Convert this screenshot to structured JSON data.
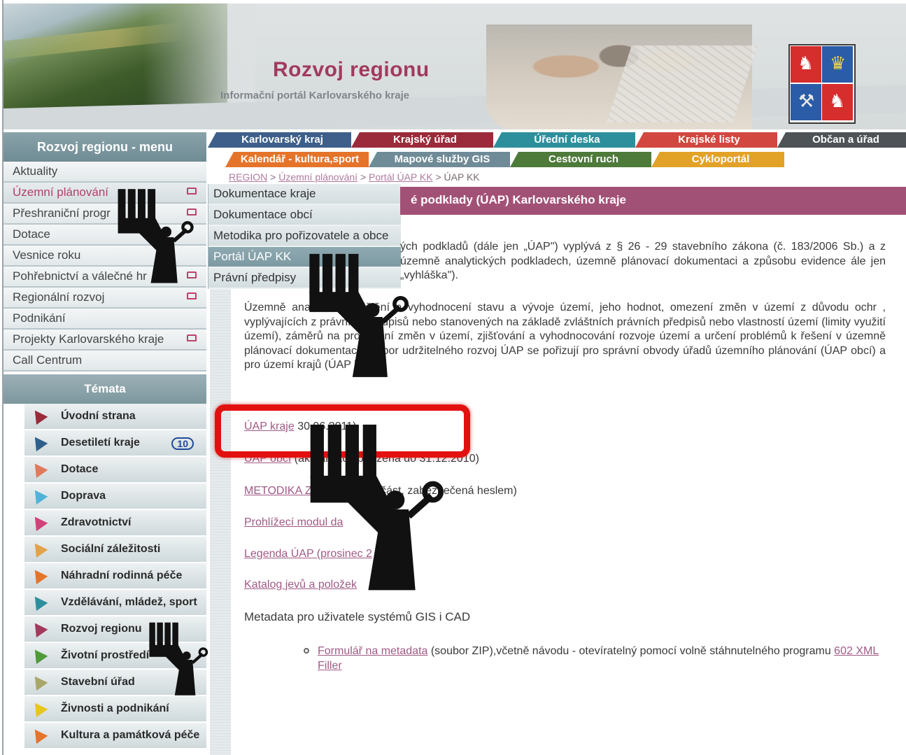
{
  "header": {
    "title": "Rozvoj regionu",
    "subtitle": "Informační portál Karlovarského kraje"
  },
  "nav_row1": [
    {
      "label": "Karlovarský kraj",
      "color": "#3d5f8a"
    },
    {
      "label": "Krajský úřad",
      "color": "#9b2b3a"
    },
    {
      "label": "Úřední deska",
      "color": "#2e8f9c"
    },
    {
      "label": "Krajské listy",
      "color": "#d2473f"
    },
    {
      "label": "Občan a úřad",
      "color": "#4d5357"
    }
  ],
  "nav_row2": [
    {
      "label": "Kalendář - kultura,sport",
      "color": "#e5742b"
    },
    {
      "label": "Mapové služby GIS",
      "color": "#6f8b97"
    },
    {
      "label": "Cestovní ruch",
      "color": "#4e7a3a"
    },
    {
      "label": "Cykloportál",
      "color": "#e2a227"
    }
  ],
  "breadcrumb": {
    "items": [
      "REGION",
      "Územní plánování",
      "Portál ÚAP KK"
    ],
    "separator": ">",
    "current": "ÚAP KK"
  },
  "left_menu": {
    "title": "Rozvoj regionu - menu",
    "items": [
      {
        "label": "Aktuality"
      },
      {
        "label": "Územní plánování",
        "active": true,
        "folder": true
      },
      {
        "label": "Přeshraniční progr",
        "folder": true
      },
      {
        "label": "Dotace"
      },
      {
        "label": "Vesnice roku"
      },
      {
        "label": "Pohřebnictví a válečné hr",
        "folder": true
      },
      {
        "label": "Regionální rozvoj",
        "folder": true
      },
      {
        "label": "Podnikání"
      },
      {
        "label": "Projekty Karlovarského kraje",
        "folder": true
      },
      {
        "label": "Call Centrum"
      }
    ]
  },
  "themes": {
    "title": "Témata",
    "items": [
      {
        "label": "Úvodní strana",
        "color": "#9b2b3a"
      },
      {
        "label": "Desetiletí kraje",
        "color": "#2e5f8a",
        "logo": "10"
      },
      {
        "label": "Dotace",
        "color": "#e07a5a"
      },
      {
        "label": "Doprava",
        "color": "#4fb3d9"
      },
      {
        "label": "Zdravotnictví",
        "color": "#d2407a"
      },
      {
        "label": "Sociální záležitosti",
        "color": "#e2a24a"
      },
      {
        "label": "Náhradní rodinná péče",
        "color": "#e5742b"
      },
      {
        "label": "Vzdělávání, mládež, sport",
        "color": "#2e8f9c"
      },
      {
        "label": "Rozvoj regionu",
        "color": "#a13a5c"
      },
      {
        "label": "Životní prostředí",
        "color": "#4f9a3a"
      },
      {
        "label": "Stavební úřad",
        "color": "#a9a66a"
      },
      {
        "label": "Živnosti a podnikání",
        "color": "#e8c61f"
      },
      {
        "label": "Kultura a památková péče",
        "color": "#e5742b"
      }
    ]
  },
  "submenu": {
    "items": [
      {
        "label": "Dokumentace kraje"
      },
      {
        "label": "Dokumentace obcí"
      },
      {
        "label": "Metodika pro pořizovatele a obce"
      },
      {
        "label": "Portál ÚAP KK",
        "active": true
      },
      {
        "label": "Právní předpisy"
      }
    ]
  },
  "content": {
    "title": "é podklady (ÚAP) Karlovarského kraje",
    "intro": "ých podkladů (dále jen „ÚAP\") vyplývá z § 26 - 29 stavebního zákona (č. 183/2006 Sb.) a z územně analytických podkladech, územně plánovací dokumentaci a způsobu evidence ále jen „vyhláška\").",
    "body": "Územně anal sahují zjištění a vyhodnocení stavu a vývoje území, jeho hodnot, omezení změn v území z důvodu ochr , vyplývajících z právních předpisů nebo stanovených na základě zvláštních právních předpisů nebo vlastností území (limity využití území), záměrů na provedení změn v území, zjišťování a vyhodnocování rozvoje území a určení problémů k řešení v územně plánovací dokumentaci (rozbor udržitelného rozvoj ÚAP se pořizují pro správní obvody úřadů územního plánování (ÚAP obcí) a pro území krajů (ÚAP krajů).",
    "links": [
      {
        "text": "ÚAP kraje",
        "suffix": "30.06.2011)"
      },
      {
        "text": "ÚAP obcí",
        "suffix": "(aktualizace pořízená do 31.12.2010)"
      },
      {
        "text": "METODIKA ZP",
        "suffix": "/ neveřejná část, zabezpečená heslem)"
      },
      {
        "text": "Prohlížecí modul da",
        "suffix": ""
      },
      {
        "text": "Legenda ÚAP (prosinec 2",
        "suffix": ""
      },
      {
        "text": "Katalog jevů a položek",
        "suffix": ""
      }
    ],
    "metadata_label": "Metadata pro uživatele systémů GIS i CAD",
    "form": {
      "link": "Formulář na metadata",
      "text": " (soubor ZIP),včetně návodu - otevíratelný pomocí volně stáhnutelného programu ",
      "link2": "602 XML Filler"
    }
  }
}
